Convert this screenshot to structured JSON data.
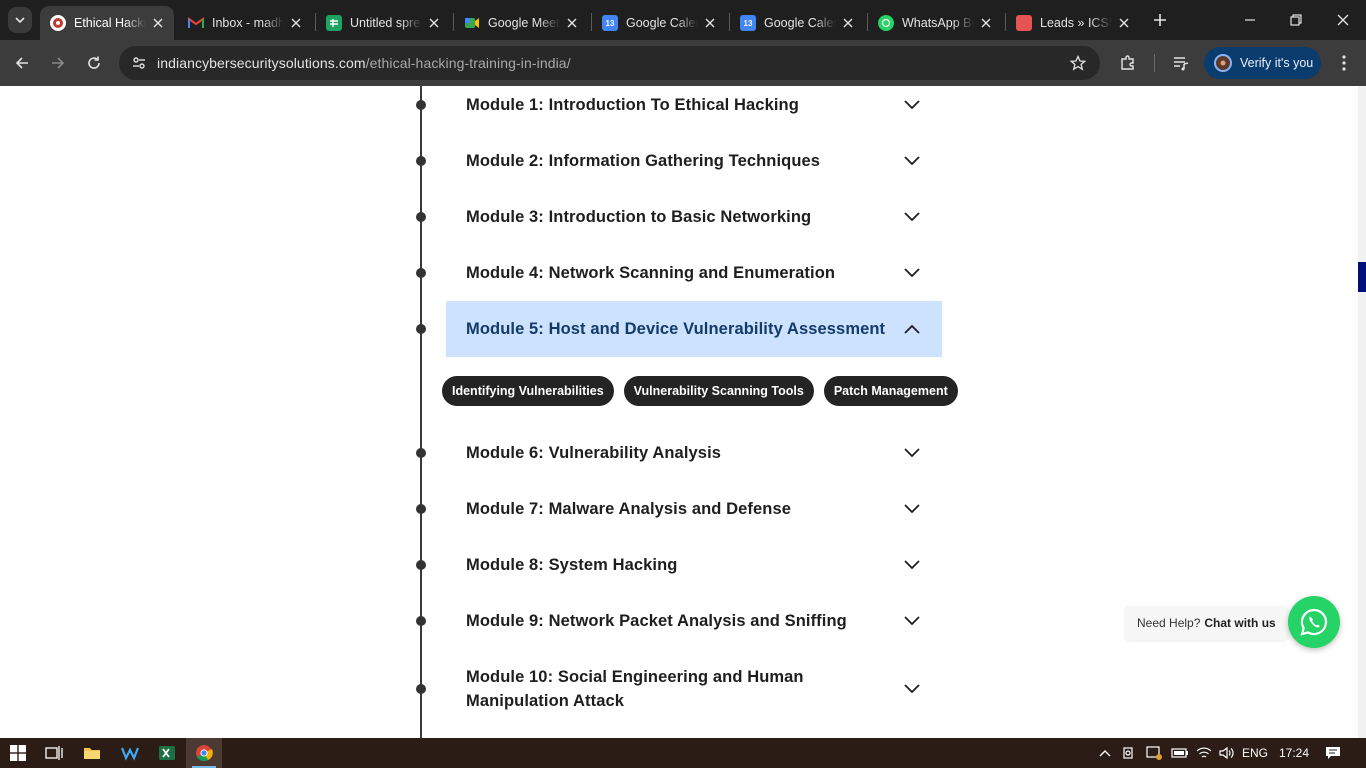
{
  "tabs": [
    {
      "title": "Ethical Hacking Training in India",
      "active": true,
      "icon": "site-icon"
    },
    {
      "title": "Inbox - madhu",
      "active": false,
      "icon": "gmail-icon"
    },
    {
      "title": "Untitled spreadsheet",
      "active": false,
      "icon": "sheets-icon"
    },
    {
      "title": "Google Meet",
      "active": false,
      "icon": "meet-icon"
    },
    {
      "title": "Google Calendar",
      "active": false,
      "icon": "calendar-icon"
    },
    {
      "title": "Google Calendar",
      "active": false,
      "icon": "calendar-icon"
    },
    {
      "title": "WhatsApp Business",
      "active": false,
      "icon": "whatsapp-icon"
    },
    {
      "title": "Leads » ICSS",
      "active": false,
      "icon": "leads-icon"
    }
  ],
  "toolbar": {
    "url_host": "indiancybersecuritysolutions.com",
    "url_path": "/ethical-hacking-training-in-india/",
    "verify_label": "Verify it's you"
  },
  "modules": [
    {
      "title": "Module 1: Introduction To Ethical Hacking",
      "expanded": false
    },
    {
      "title": "Module 2: Information Gathering Techniques",
      "expanded": false
    },
    {
      "title": "Module 3: Introduction to Basic Networking",
      "expanded": false
    },
    {
      "title": "Module 4: Network Scanning and Enumeration",
      "expanded": false
    },
    {
      "title": "Module 5: Host and Device Vulnerability Assessment",
      "expanded": true
    },
    {
      "title": "Module 6: Vulnerability Analysis",
      "expanded": false
    },
    {
      "title": "Module 7: Malware Analysis and Defense",
      "expanded": false
    },
    {
      "title": "Module 8: System Hacking",
      "expanded": false
    },
    {
      "title": "Module 9: Network Packet Analysis and Sniffing",
      "expanded": false
    },
    {
      "title": "Module 10: Social Engineering and Human Manipulation Attack",
      "expanded": false
    }
  ],
  "module5_topics": [
    "Identifying Vulnerabilities",
    "Vulnerability Scanning Tools",
    "Patch Management"
  ],
  "help": {
    "prefix": "Need Help?",
    "link": "Chat with us"
  },
  "taskbar": {
    "language": "ENG",
    "time": "17:24"
  },
  "colors": {
    "accent_open": "#cce2ff",
    "whatsapp": "#25d366",
    "pill": "#242424",
    "verify_bg": "#0b3c6e"
  }
}
